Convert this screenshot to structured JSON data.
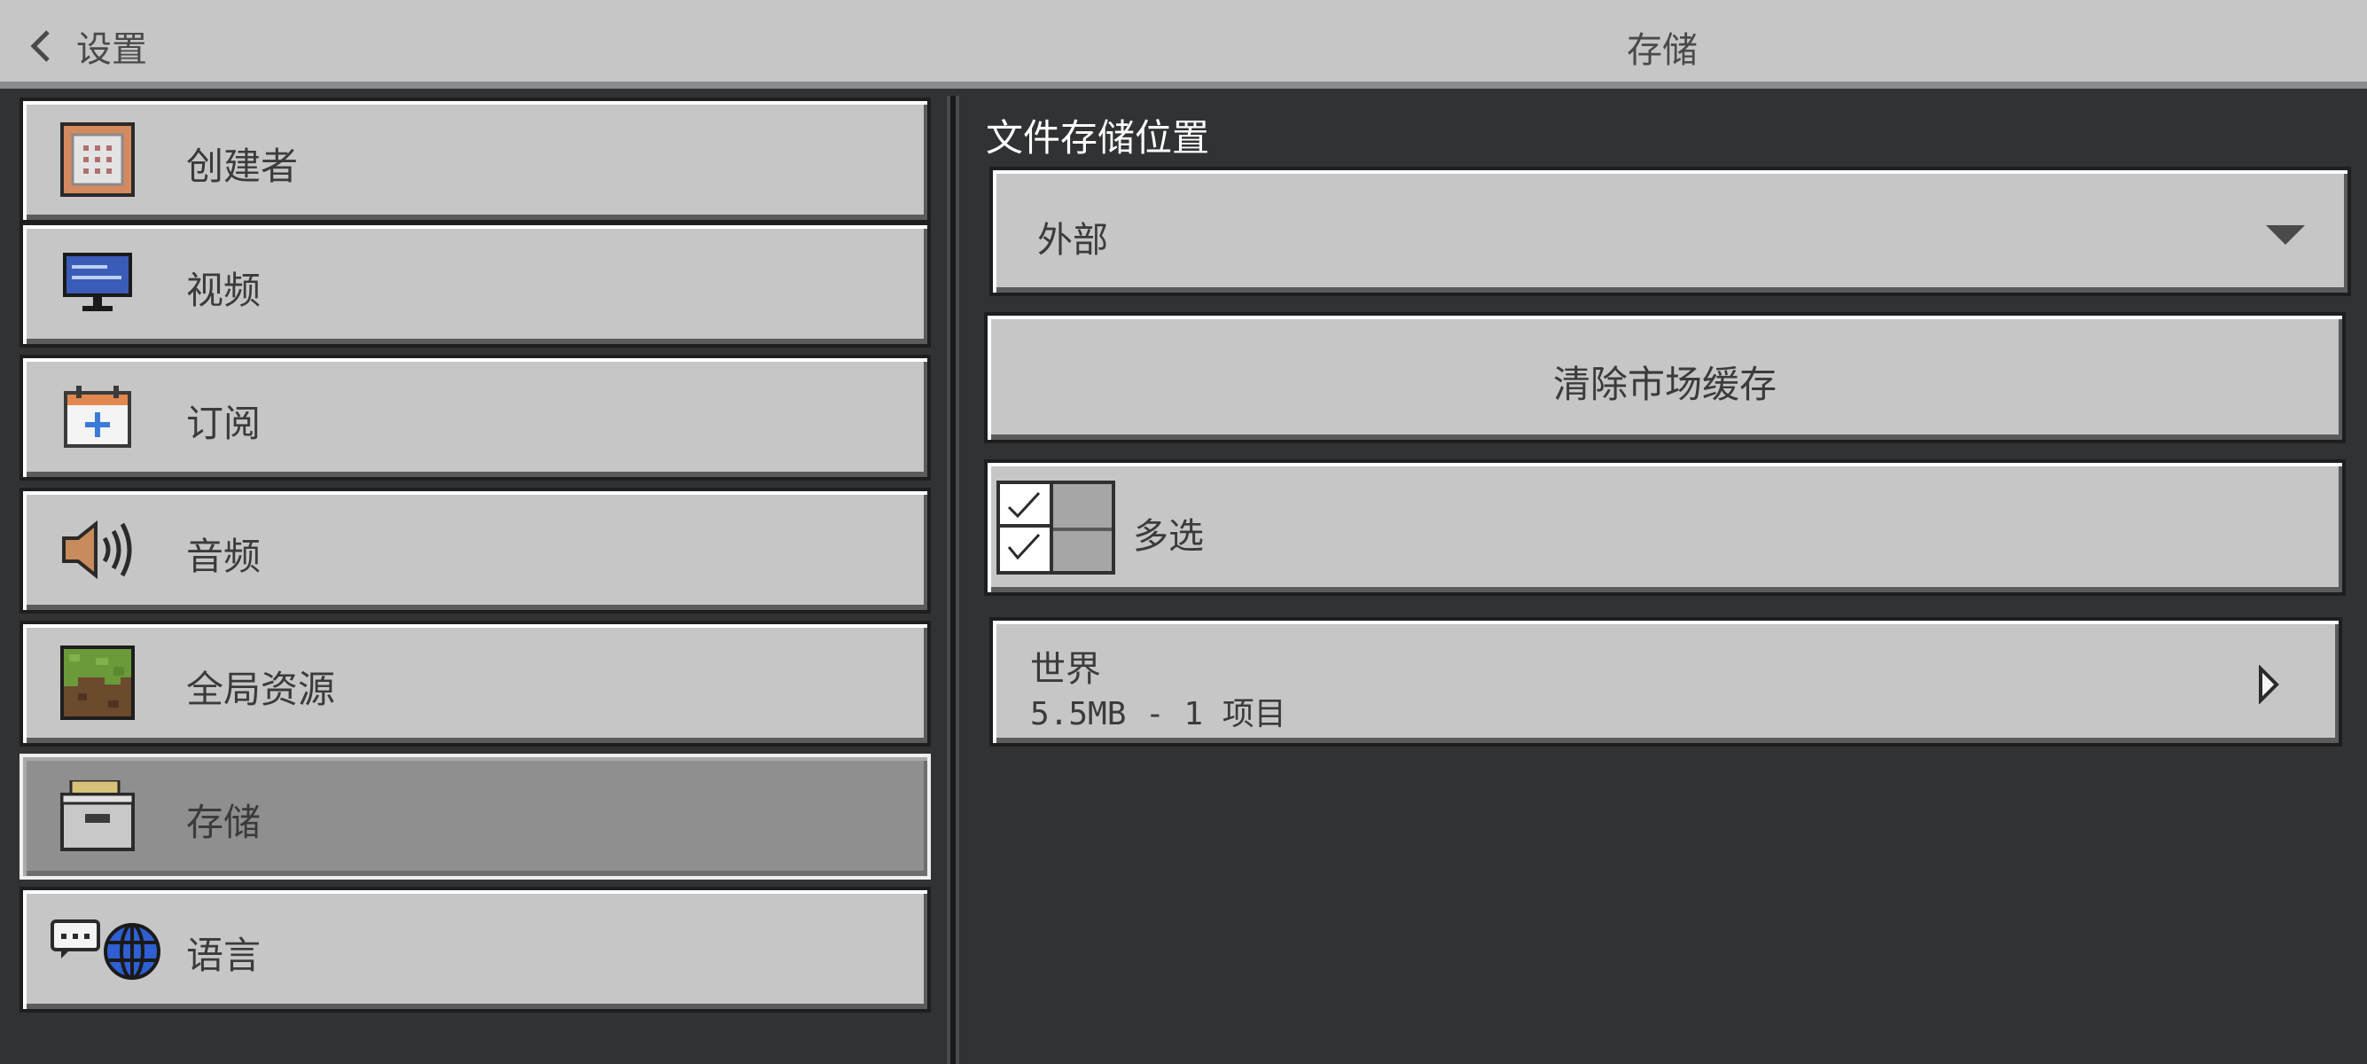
{
  "header": {
    "back_label": "设置",
    "title": "存储"
  },
  "sidebar": {
    "items": [
      {
        "label": "创建者",
        "icon": "command-block-icon"
      },
      {
        "label": "视频",
        "icon": "monitor-icon"
      },
      {
        "label": "订阅",
        "icon": "subscription-calendar-icon"
      },
      {
        "label": "音频",
        "icon": "speaker-icon"
      },
      {
        "label": "全局资源",
        "icon": "grass-block-icon"
      },
      {
        "label": "存储",
        "icon": "storage-box-icon",
        "selected": true
      },
      {
        "label": "语言",
        "icon": "language-globe-icon"
      }
    ]
  },
  "storage": {
    "location_label": "文件存储位置",
    "location_value": "外部",
    "clear_cache_label": "清除市场缓存",
    "multiselect_label": "多选",
    "world": {
      "name": "世界",
      "meta": "5.5MB - 1 项目"
    }
  },
  "colors": {
    "background": "#313233",
    "button": "#c6c6c6",
    "selected": "#8f8f8f"
  }
}
